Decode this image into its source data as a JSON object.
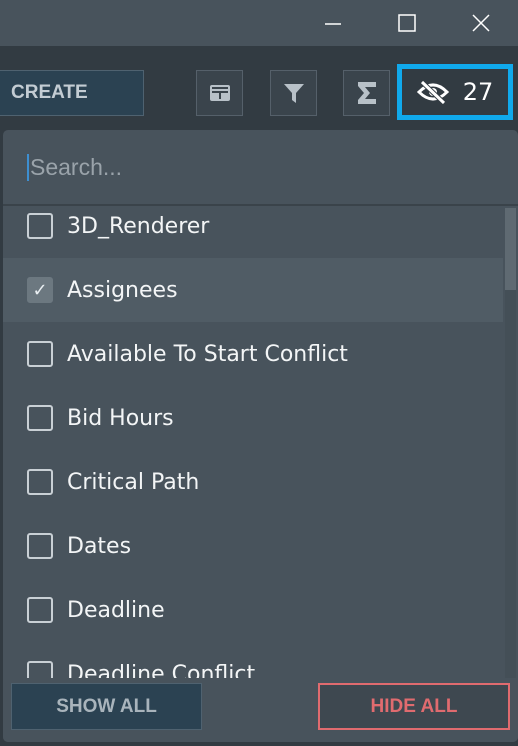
{
  "toolbar": {
    "create_label": "CREATE",
    "hidden_count": "27"
  },
  "search": {
    "placeholder": "Search...",
    "value": ""
  },
  "fields": [
    {
      "label": "3D_Renderer",
      "checked": false
    },
    {
      "label": "Assignees",
      "checked": true
    },
    {
      "label": "Available To Start Conflict",
      "checked": false
    },
    {
      "label": "Bid Hours",
      "checked": false
    },
    {
      "label": "Critical Path",
      "checked": false
    },
    {
      "label": "Dates",
      "checked": false
    },
    {
      "label": "Deadline",
      "checked": false
    },
    {
      "label": "Deadline Conflict",
      "checked": false
    }
  ],
  "footer": {
    "show_all": "SHOW ALL",
    "hide_all": "HIDE ALL"
  },
  "colors": {
    "highlight": "#10a9ec",
    "danger": "#e06b6f"
  }
}
